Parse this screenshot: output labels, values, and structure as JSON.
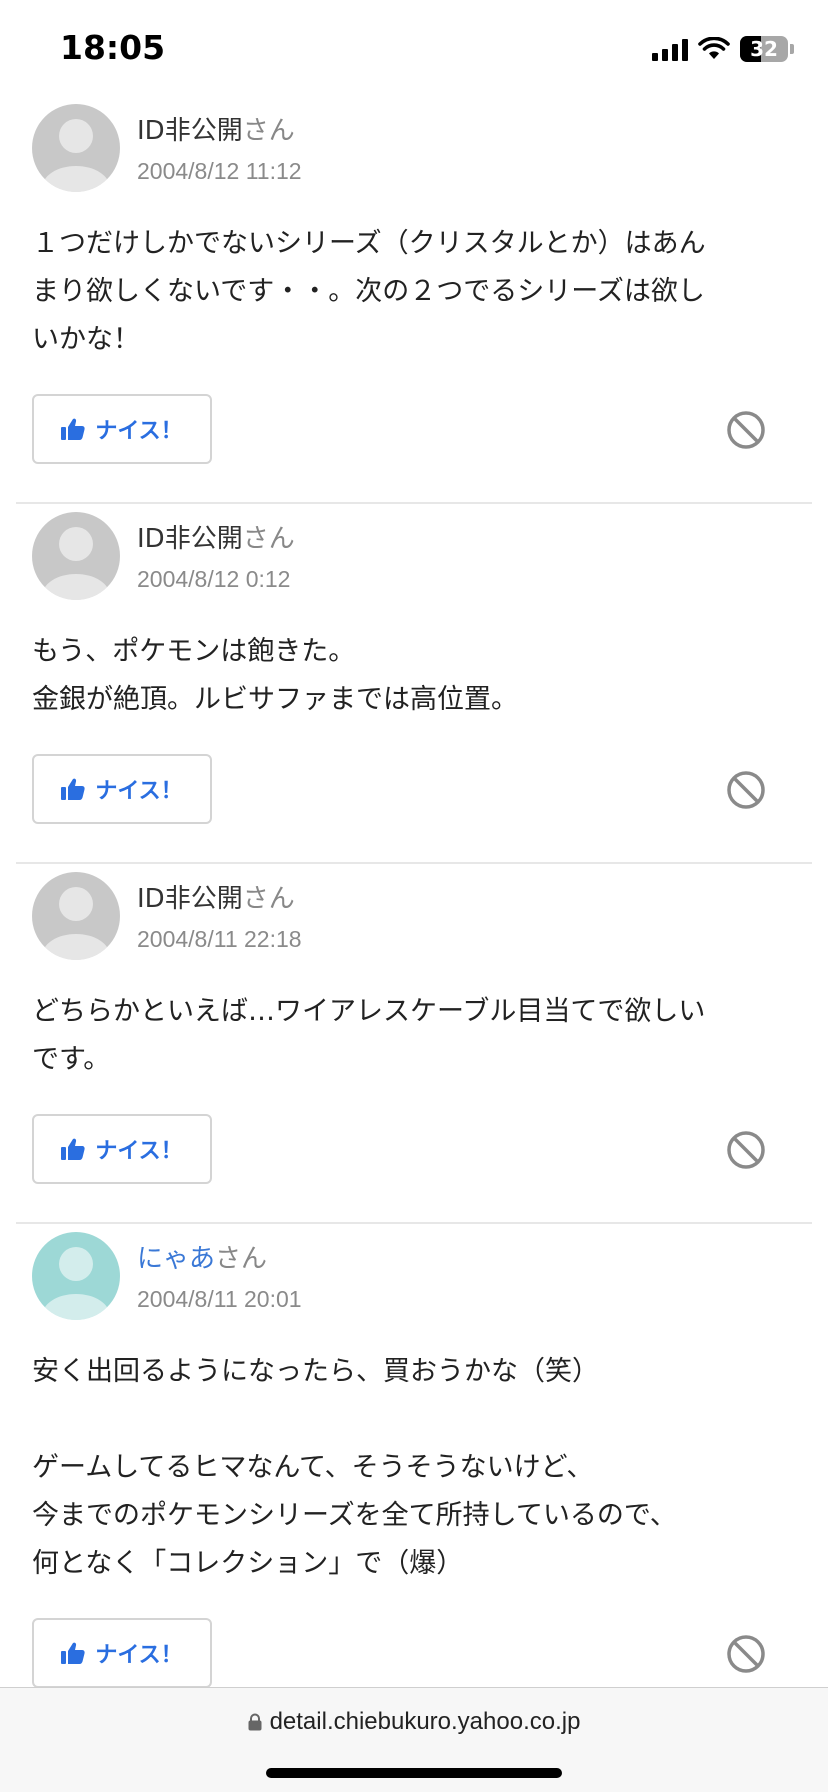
{
  "status_bar": {
    "time": "18:05",
    "battery_level": "32"
  },
  "answers": [
    {
      "user": "ID非公開",
      "honorific": "さん",
      "date": "2004/8/12 11:12",
      "avatar_color": "#c8c8c8",
      "lines": [
        "１つだけしかでないシリーズ（クリスタルとか）はあん",
        "まり欲しくないです・・。次の２つでるシリーズは欲し",
        "いかな！"
      ],
      "nice_label": "ナイス！"
    },
    {
      "user": "ID非公開",
      "honorific": "さん",
      "date": "2004/8/12 0:12",
      "avatar_color": "#c8c8c8",
      "lines": [
        "もう、ポケモンは飽きた。",
        "金銀が絶頂。ルビサファまでは高位置。"
      ],
      "nice_label": "ナイス！"
    },
    {
      "user": "ID非公開",
      "honorific": "さん",
      "date": "2004/8/11 22:18",
      "avatar_color": "#c8c8c8",
      "lines": [
        "どちらかといえば…ワイアレスケーブル目当てで欲しい",
        "です。"
      ],
      "nice_label": "ナイス！"
    },
    {
      "user": "にゃあ",
      "honorific": "さん",
      "date": "2004/8/11 20:01",
      "avatar_color": "#9dd8d6",
      "lines": [
        "安く出回るようになったら、買おうかな（笑）",
        "",
        "ゲームしてるヒマなんて、そうそうないけど、",
        "今までのポケモンシリーズを全て所持しているので、",
        "何となく「コレクション」で（爆）"
      ],
      "nice_label": "ナイス！"
    }
  ],
  "browser": {
    "url": "detail.chiebukuro.yahoo.co.jp"
  },
  "colors": {
    "accent": "#2a6ee0",
    "link": "#3a78d6",
    "muted": "#8a8a8a",
    "divider": "#e7e7e7"
  }
}
